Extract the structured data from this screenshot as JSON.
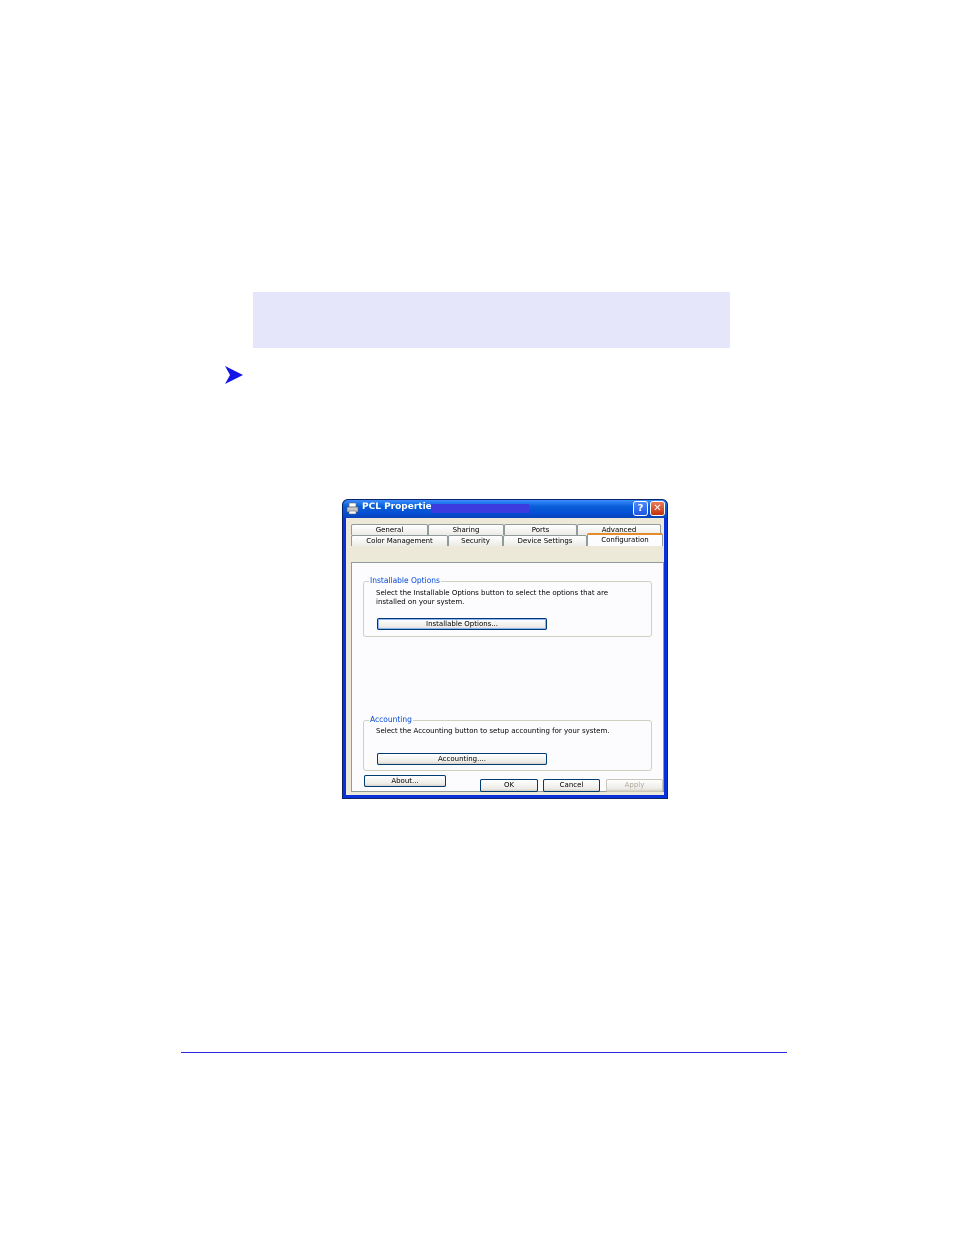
{
  "dialog": {
    "title": "PCL Properties",
    "help_button": "?",
    "close_button": "✕",
    "tabs_row1": [
      "General",
      "Sharing",
      "Ports",
      "Advanced"
    ],
    "tabs_row2": [
      "Color Management",
      "Security",
      "Device Settings",
      "Configuration"
    ],
    "active_tab": "Configuration",
    "installable_options": {
      "title": "Installable Options",
      "description": "Select the Installable Options button to select the options that are\ninstalled on your system.",
      "button": "Installable Options..."
    },
    "accounting": {
      "title": "Accounting",
      "description": "Select the Accounting button to setup accounting for your system.",
      "button": "Accounting...."
    },
    "about_button": "About...",
    "footer": {
      "ok": "OK",
      "cancel": "Cancel",
      "apply": "Apply"
    }
  },
  "icons": {
    "bullet": "arrow-right-icon",
    "title": "printer-icon"
  },
  "colors": {
    "note_box": "#e6e6fa",
    "arrow": "#1414e6",
    "rule": "#2a2ae0",
    "titlebar": "#0550d6",
    "active_tab_accent": "#e68b2c"
  }
}
